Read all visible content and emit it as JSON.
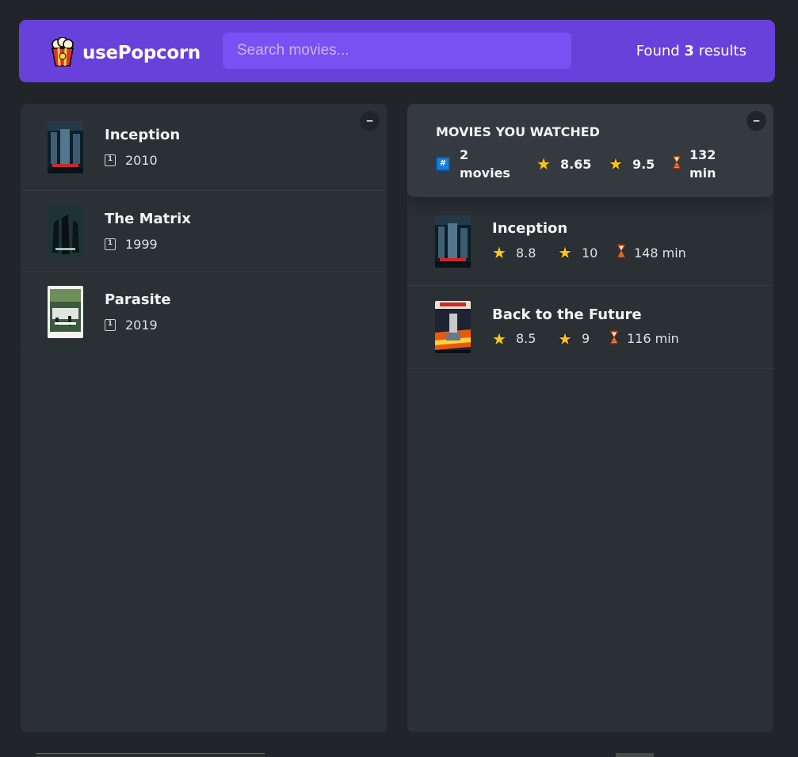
{
  "header": {
    "logo_icon": "popcorn-icon",
    "app_name": "usePopcorn",
    "search_placeholder": "Search movies...",
    "results_prefix": "Found",
    "results_count": "3",
    "results_suffix": "results"
  },
  "search_results": {
    "toggle_label": "–",
    "movies": [
      {
        "title": "Inception",
        "year": "2010",
        "poster": "inception-poster"
      },
      {
        "title": "The Matrix",
        "year": "1999",
        "poster": "matrix-poster"
      },
      {
        "title": "Parasite",
        "year": "2019",
        "poster": "parasite-poster"
      }
    ]
  },
  "watched": {
    "toggle_label": "–",
    "summary": {
      "heading": "Movies you watched",
      "num_movies_value": "2",
      "num_movies_unit": "movies",
      "avg_imdb": "8.65",
      "avg_user": "9.5",
      "avg_runtime_value": "132",
      "avg_runtime_unit": "min"
    },
    "movies": [
      {
        "title": "Inception",
        "imdb": "8.8",
        "user": "10",
        "runtime": "148 min",
        "poster": "inception-poster"
      },
      {
        "title": "Back to the Future",
        "imdb": "8.5",
        "user": "9",
        "runtime": "116 min",
        "poster": "back-to-the-future-poster"
      }
    ]
  },
  "colors": {
    "navbar": "#6741d9",
    "search_bg": "#7950f2",
    "page_bg": "#212529",
    "box_bg": "#2b3035",
    "summary_bg": "#343a40",
    "star": "#fcc419"
  }
}
